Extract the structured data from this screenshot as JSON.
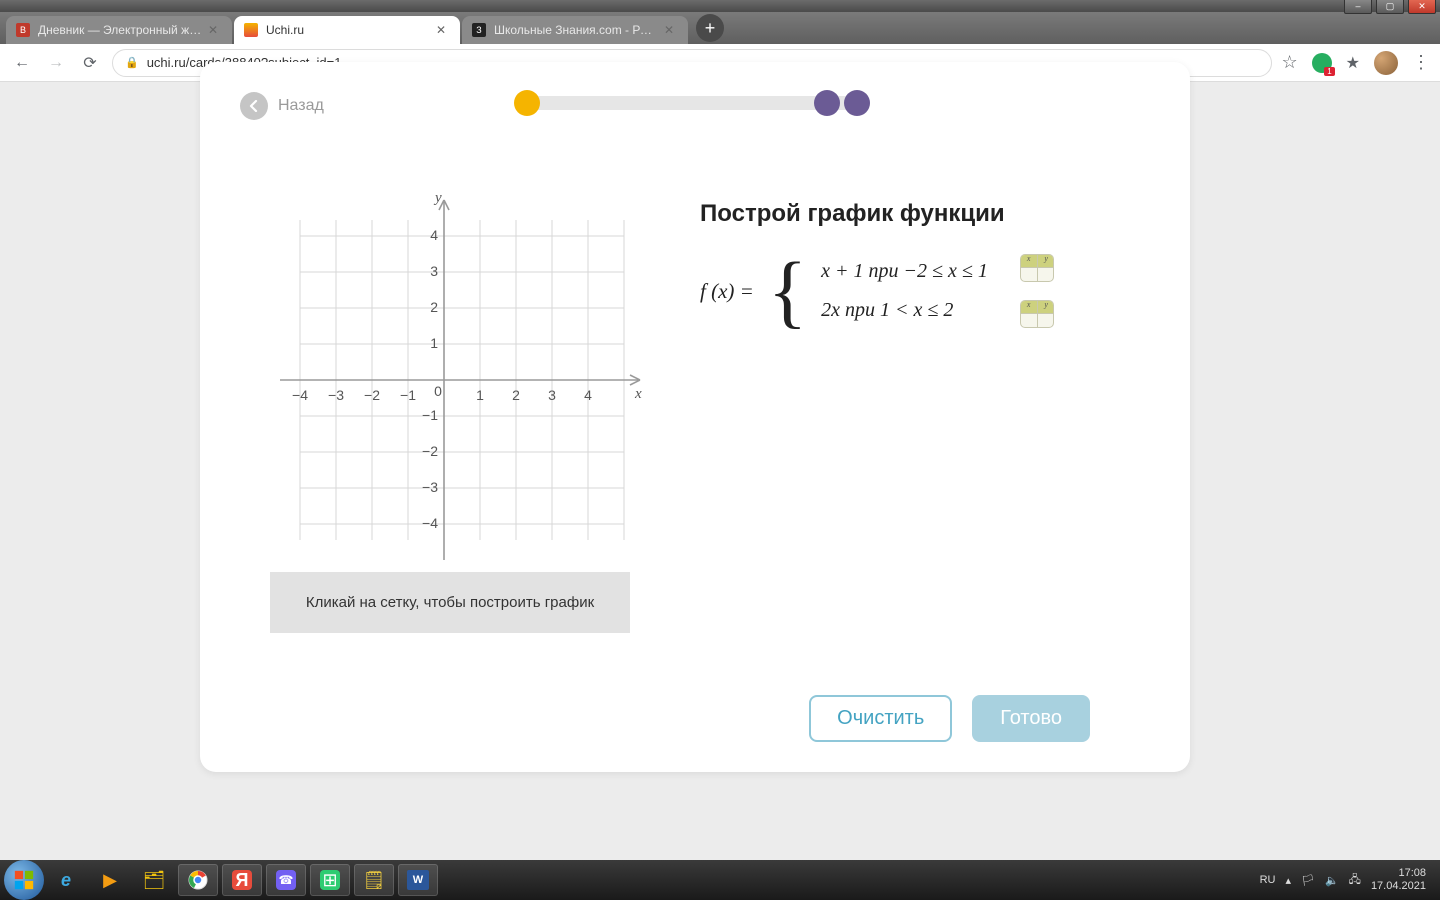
{
  "window": {
    "controls": {
      "min": "–",
      "max": "▢",
      "close": "✕"
    }
  },
  "tabs": [
    {
      "title": "Дневник — Электронный журн",
      "favicon_bg": "#c0392b",
      "favicon_text": "В",
      "active": false
    },
    {
      "title": "Uchi.ru",
      "favicon_bg": "#4aa3df",
      "favicon_text": "",
      "active": true
    },
    {
      "title": "Школьные Знания.com - Решае",
      "favicon_bg": "#222",
      "favicon_text": "З",
      "active": false
    }
  ],
  "newtab": "+",
  "addr": {
    "back": "←",
    "fwd": "→",
    "reload": "⟳",
    "lock": "🔒",
    "url": "uchi.ru/cards/38840?subject_id=1",
    "star": "☆",
    "ext_badge": "1",
    "puzzle": "✦",
    "menu": "⋮"
  },
  "page": {
    "back_label": "Назад",
    "axis": {
      "y_label": "y",
      "x_label": "x",
      "x_ticks": [
        "−4",
        "−3",
        "−2",
        "−1",
        "0",
        "1",
        "2",
        "3",
        "4"
      ],
      "y_ticks": [
        "4",
        "3",
        "2",
        "1",
        "−1",
        "−2",
        "−3",
        "−4"
      ]
    },
    "task_title": "Построй график функции",
    "formula_left": "f (x) =",
    "cases": [
      "x + 1   npu   −2 ≤ x ≤ 1",
      "2x   npu   1 < x ≤ 2"
    ],
    "table_hdr": {
      "x": "x",
      "y": "y"
    },
    "hint": "Кликай на сетку, чтобы построить график",
    "btn_clear": "Очистить",
    "btn_done": "Готово"
  },
  "taskbar": {
    "lang": "RU",
    "time": "17:08",
    "date": "17.04.2021"
  }
}
